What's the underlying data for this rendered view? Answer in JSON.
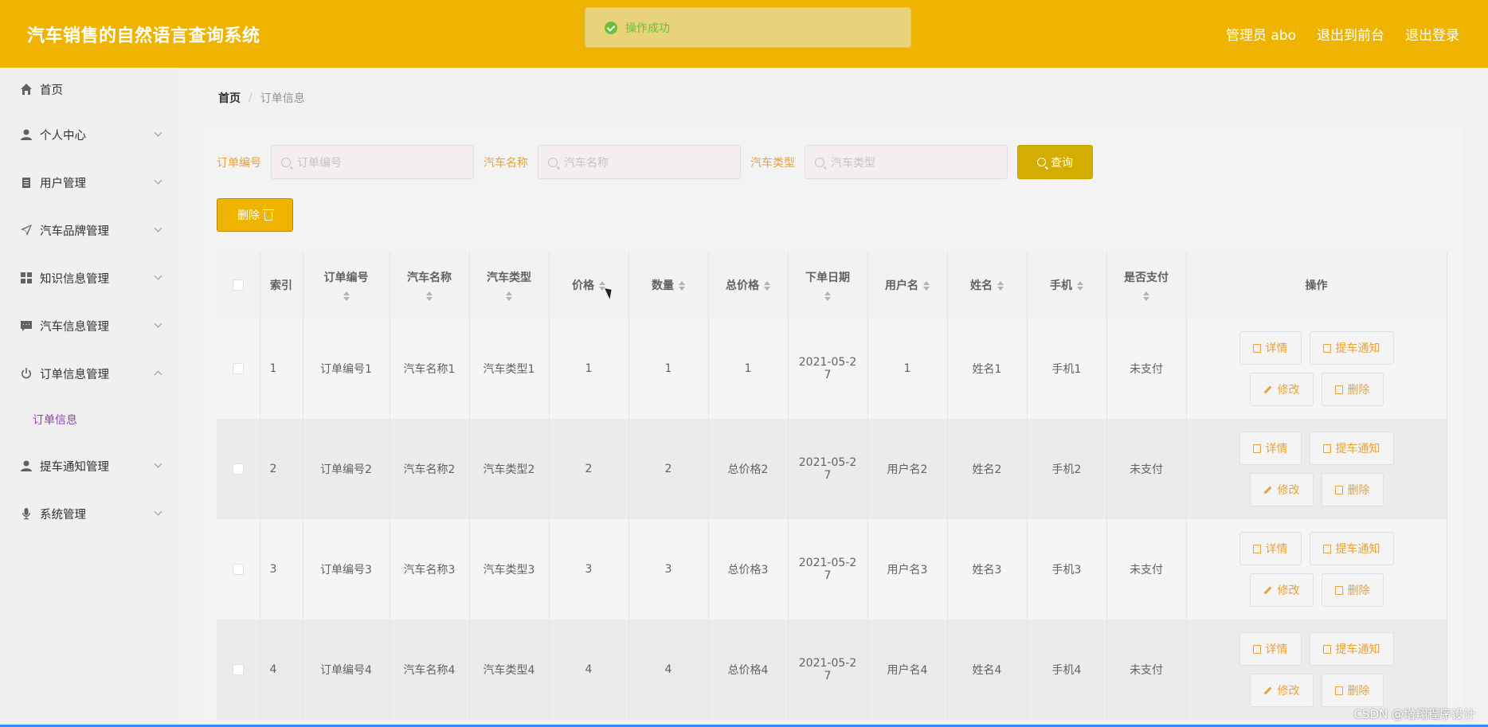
{
  "header": {
    "title": "汽车销售的自然语言查询系统",
    "admin": "管理员 abo",
    "front": "退出到前台",
    "logout": "退出登录"
  },
  "toast": {
    "text": "操作成功"
  },
  "sidebar": {
    "items": [
      {
        "label": "首页",
        "icon": "home-icon"
      },
      {
        "label": "个人中心",
        "icon": "user-icon"
      },
      {
        "label": "用户管理",
        "icon": "clipboard-icon"
      },
      {
        "label": "汽车品牌管理",
        "icon": "navigation-icon"
      },
      {
        "label": "知识信息管理",
        "icon": "grid-icon"
      },
      {
        "label": "汽车信息管理",
        "icon": "message-icon"
      },
      {
        "label": "订单信息管理",
        "icon": "power-icon"
      },
      {
        "label": "提车通知管理",
        "icon": "user-icon"
      },
      {
        "label": "系统管理",
        "icon": "microphone-icon"
      }
    ],
    "subitem": "订单信息"
  },
  "breadcrumb": {
    "home": "首页",
    "sep": "/",
    "current": "订单信息"
  },
  "search": {
    "order_label": "订单编号",
    "order_placeholder": "订单编号",
    "car_label": "汽车名称",
    "car_placeholder": "汽车名称",
    "type_label": "汽车类型",
    "type_placeholder": "汽车类型",
    "query_label": "查询"
  },
  "toolbar": {
    "delete_label": "删除"
  },
  "table": {
    "headers": [
      "索引",
      "订单编号",
      "汽车名称",
      "汽车类型",
      "价格",
      "数量",
      "总价格",
      "下单日期",
      "用户名",
      "姓名",
      "手机",
      "是否支付",
      "操作"
    ],
    "rows": [
      {
        "idx": "1",
        "order": "订单编号1",
        "car": "汽车名称1",
        "type": "汽车类型1",
        "price": "1",
        "qty": "1",
        "total": "1",
        "date1": "2021-05-2",
        "date2": "7",
        "user": "1",
        "name": "姓名1",
        "phone": "手机1",
        "paid": "未支付"
      },
      {
        "idx": "2",
        "order": "订单编号2",
        "car": "汽车名称2",
        "type": "汽车类型2",
        "price": "2",
        "qty": "2",
        "total": "总价格2",
        "date1": "2021-05-2",
        "date2": "7",
        "user": "用户名2",
        "name": "姓名2",
        "phone": "手机2",
        "paid": "未支付"
      },
      {
        "idx": "3",
        "order": "订单编号3",
        "car": "汽车名称3",
        "type": "汽车类型3",
        "price": "3",
        "qty": "3",
        "total": "总价格3",
        "date1": "2021-05-2",
        "date2": "7",
        "user": "用户名3",
        "name": "姓名3",
        "phone": "手机3",
        "paid": "未支付"
      },
      {
        "idx": "4",
        "order": "订单编号4",
        "car": "汽车名称4",
        "type": "汽车类型4",
        "price": "4",
        "qty": "4",
        "total": "总价格4",
        "date1": "2021-05-2",
        "date2": "7",
        "user": "用户名4",
        "name": "姓名4",
        "phone": "手机4",
        "paid": "未支付"
      }
    ],
    "ops": {
      "detail": "详情",
      "notify": "提车通知",
      "edit": "修改",
      "delete": "删除"
    }
  },
  "watermark": "CSDN @增翔程序设计",
  "colors": {
    "header": "#efb401",
    "accent": "#e6a23c",
    "query": "#d4ad00",
    "success": "#67c23a"
  }
}
